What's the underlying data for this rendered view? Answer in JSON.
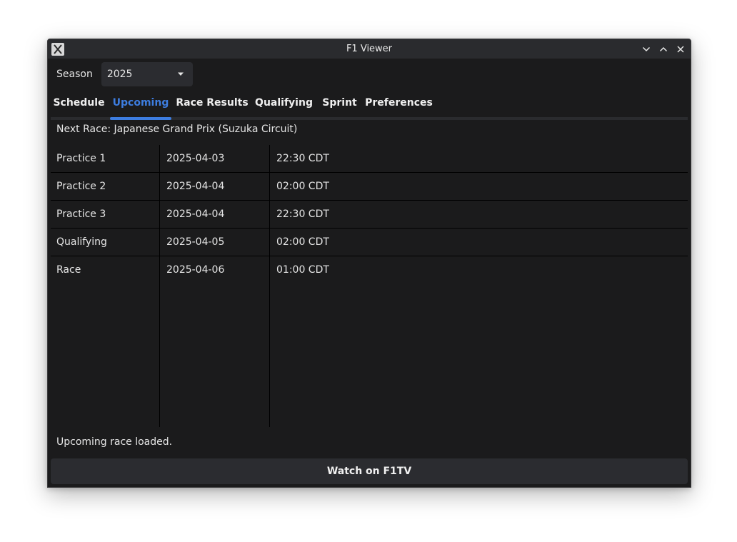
{
  "window": {
    "title": "F1 Viewer",
    "icon": "x-app-icon"
  },
  "season": {
    "label": "Season",
    "selected": "2025"
  },
  "tabs": [
    {
      "label": "Schedule",
      "active": false
    },
    {
      "label": "Upcoming",
      "active": true
    },
    {
      "label": "Race Results",
      "active": false
    },
    {
      "label": "Qualifying",
      "active": false
    },
    {
      "label": "Sprint",
      "active": false
    },
    {
      "label": "Preferences",
      "active": false
    }
  ],
  "upcoming": {
    "next_race": "Next Race: Japanese Grand Prix (Suzuka Circuit)",
    "sessions": [
      {
        "session": "Practice 1",
        "date": "2025-04-03",
        "time": "22:30 CDT"
      },
      {
        "session": "Practice 2",
        "date": "2025-04-04",
        "time": "02:00 CDT"
      },
      {
        "session": "Practice 3",
        "date": "2025-04-04",
        "time": "22:30 CDT"
      },
      {
        "session": "Qualifying",
        "date": "2025-04-05",
        "time": "02:00 CDT"
      },
      {
        "session": "Race",
        "date": "2025-04-06",
        "time": "01:00 CDT"
      }
    ]
  },
  "status": "Upcoming race loaded.",
  "watch_button": "Watch on F1TV",
  "colors": {
    "accent": "#3d7de0",
    "window_bg": "#1b1b1c",
    "titlebar_bg": "#2a2b2e",
    "control_bg": "#2b2c30",
    "text": "#e6e6e6"
  }
}
